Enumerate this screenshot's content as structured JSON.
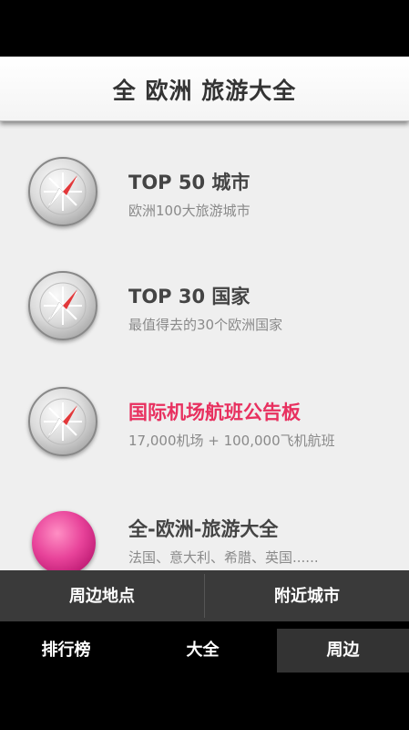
{
  "header": {
    "title": "全 欧洲 旅游大全"
  },
  "list": [
    {
      "title": "TOP 50 城市",
      "subtitle": "欧洲100大旅游城市",
      "icon": "compass-icon"
    },
    {
      "title": "TOP 30 国家",
      "subtitle": "最值得去的30个欧洲国家",
      "icon": "compass-icon"
    },
    {
      "title": "国际机场航班公告板",
      "subtitle": "17,000机场 + 100,000飞机航班",
      "icon": "compass-icon"
    },
    {
      "title": "全-欧洲-旅游大全",
      "subtitle": "法国、意大利、希腊、英国......",
      "icon": "pink-ball-icon"
    }
  ],
  "subnav": {
    "left": "周边地点",
    "right": "附近城市"
  },
  "tabs": [
    {
      "label": "排行榜"
    },
    {
      "label": "大全"
    },
    {
      "label": "周边",
      "active": true
    }
  ],
  "colors": {
    "highlight": "#e8305f",
    "accent_pink": "#e8439a"
  }
}
